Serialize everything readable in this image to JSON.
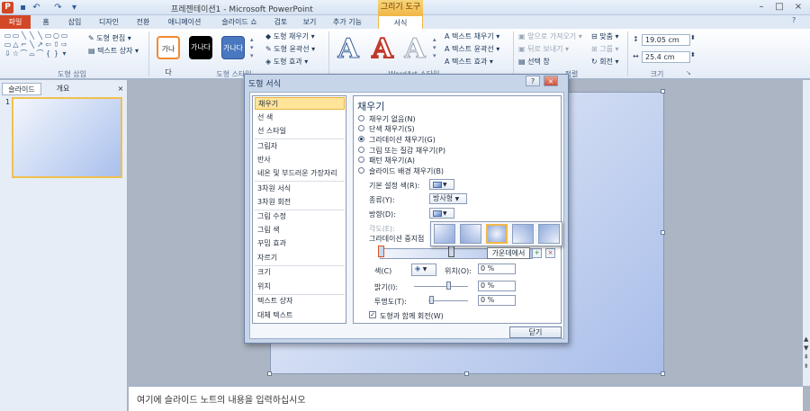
{
  "window": {
    "title": "프레젠테이션1 - Microsoft PowerPoint",
    "context_tab_group": "그리기 도구",
    "min": "–",
    "max": "□",
    "close": "×"
  },
  "tabs": [
    "파일",
    "홈",
    "삽입",
    "디자인",
    "전환",
    "애니메이션",
    "슬라이드 쇼",
    "검토",
    "보기",
    "추가 기능",
    "서식"
  ],
  "ribbon": {
    "insert_shapes": {
      "label": "도형 삽입",
      "edit_shape": "도형 편집",
      "text_box": "텍스트 상자"
    },
    "shape_styles": {
      "label": "도형 스타일",
      "sample_text": "가나다",
      "fill": "도형 채우기",
      "outline": "도형 윤곽선",
      "effects": "도형 효과"
    },
    "wordart_styles": {
      "label": "WordArt 스타일",
      "text_fill": "텍스트 채우기",
      "text_outline": "텍스트 윤곽선",
      "text_effects": "텍스트 효과"
    },
    "arrange": {
      "label": "정렬",
      "bring_forward": "앞으로 가져오기",
      "send_backward": "뒤로 보내기",
      "selection_pane": "선택 창",
      "align": "맞춤",
      "group": "그룹",
      "rotate": "회전"
    },
    "size": {
      "label": "크기",
      "height": "19.05 cm",
      "width": "25.4 cm"
    }
  },
  "left_pane": {
    "tab_slides": "슬라이드",
    "tab_outline": "개요",
    "slide_number": "1"
  },
  "notes_placeholder": "여기에 슬라이드 노트의 내용을 입력하십시오",
  "dialog": {
    "title": "도형 서식",
    "help": "?",
    "categories": [
      "채우기",
      "선 색",
      "선 스타일",
      "그림자",
      "반사",
      "네온 및 부드러운 가장자리",
      "3차원 서식",
      "3차원 회전",
      "그림 수정",
      "그림 색",
      "꾸밈 효과",
      "자르기",
      "크기",
      "위치",
      "텍스트 상자",
      "대체 텍스트"
    ],
    "panel_title": "채우기",
    "fill_options": [
      "채우기 없음(N)",
      "단색 채우기(S)",
      "그라데이션 채우기(G)",
      "그림 또는 질감 채우기(P)",
      "패턴 채우기(A)",
      "슬라이드 배경 채우기(B)"
    ],
    "preset_colors": "기본 설정 색(R):",
    "type_label": "종류(Y):",
    "type_value": "방사형",
    "direction_label": "방향(D):",
    "angle_label": "각도(E):",
    "gradient_stops": "그라데이션 중지점",
    "color_label": "색(C)",
    "position_label": "위치(O):",
    "position_value": "0 %",
    "brightness_label": "밝기(I):",
    "brightness_value": "0 %",
    "transparency_label": "투명도(T):",
    "transparency_value": "0 %",
    "rotate_with_shape": "도형과 함께 회전(W)",
    "close_button": "닫기",
    "tooltip": "가운데에서"
  }
}
